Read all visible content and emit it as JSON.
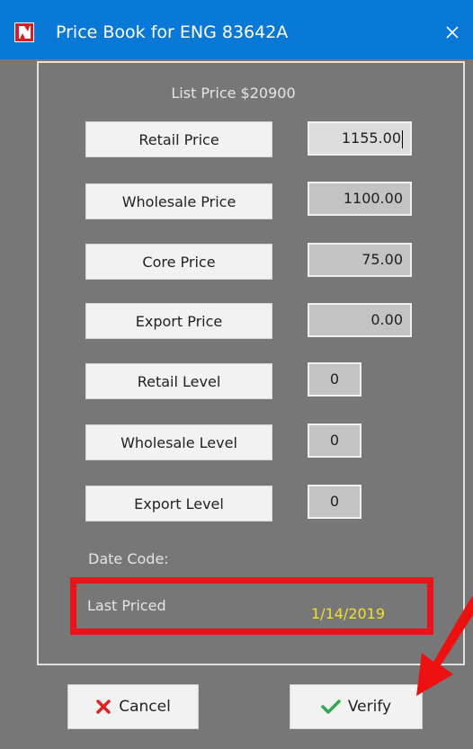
{
  "window": {
    "title": "Price Book for ENG 83642A",
    "close_icon": "close-icon",
    "app_icon": "app-logo-icon"
  },
  "panel": {
    "list_price": "List Price $20900",
    "fields": [
      {
        "label": "Retail Price",
        "value": "1155.00"
      },
      {
        "label": "Wholesale Price",
        "value": "1100.00"
      },
      {
        "label": "Core Price",
        "value": "75.00"
      },
      {
        "label": "Export Price",
        "value": "0.00"
      },
      {
        "label": "Retail Level",
        "value": "0"
      },
      {
        "label": "Wholesale Level",
        "value": "0"
      },
      {
        "label": "Export Level",
        "value": "0"
      }
    ],
    "date_code_label": "Date Code:",
    "last_priced_label": "Last Priced",
    "last_priced_value": "1/14/2019"
  },
  "buttons": {
    "cancel_label": "Cancel",
    "verify_label": "Verify"
  },
  "colors": {
    "titlebar": "#0a78d7",
    "window_bg": "#777777",
    "highlight": "#e9141a",
    "date_value": "#f0e030",
    "cancel_icon": "#e12121",
    "verify_icon": "#2fa84f"
  }
}
